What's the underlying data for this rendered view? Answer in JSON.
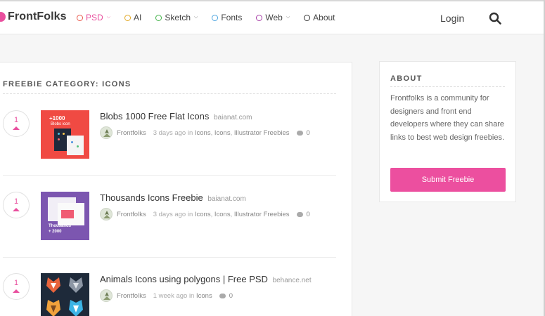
{
  "brand": {
    "name": "FrontFolks",
    "color": "#e94f9e"
  },
  "nav": {
    "items": [
      {
        "label": "PSD",
        "ring": "#e9574a",
        "active": true,
        "dropdown": true
      },
      {
        "label": "AI",
        "ring": "#e2a821",
        "active": false,
        "dropdown": false
      },
      {
        "label": "Sketch",
        "ring": "#43b34a",
        "active": false,
        "dropdown": true
      },
      {
        "label": "Fonts",
        "ring": "#4aa3df",
        "active": false,
        "dropdown": false
      },
      {
        "label": "Web",
        "ring": "#a63ca6",
        "active": false,
        "dropdown": true
      },
      {
        "label": "About",
        "ring": "#333333",
        "active": false,
        "dropdown": false
      }
    ],
    "login": "Login",
    "search_icon": "search-icon"
  },
  "category": {
    "title": "FREEBIE CATEGORY: ICONS"
  },
  "posts": [
    {
      "votes": "1",
      "title": "Blobs 1000 Free Flat Icons",
      "domain": "baianat.com",
      "author": "Frontfolks",
      "time": "3 days ago in",
      "tags": [
        "Icons",
        "Icons",
        "Illustrator Freebies"
      ],
      "comments": "0",
      "thumb_text": [
        "+1000",
        "Blobs icon"
      ]
    },
    {
      "votes": "1",
      "title": "Thousands Icons Freebie",
      "domain": "baianat.com",
      "author": "Frontfolks",
      "time": "3 days ago in",
      "tags": [
        "Icons",
        "Icons",
        "Illustrator Freebies"
      ],
      "comments": "0",
      "thumb_text": [
        "Thousands",
        "+ 2000"
      ]
    },
    {
      "votes": "1",
      "title": "Animals Icons using polygons | Free PSD",
      "domain": "behance.net",
      "author": "Frontfolks",
      "time": "1 week ago in",
      "tags": [
        "Icons"
      ],
      "comments": "0",
      "thumb_text": []
    }
  ],
  "sidebar": {
    "about_title": "ABOUT",
    "about_text": "Frontfolks is a community for designers and front end developers where they can share links to best web design freebies.",
    "submit_label": "Submit Freebie"
  }
}
